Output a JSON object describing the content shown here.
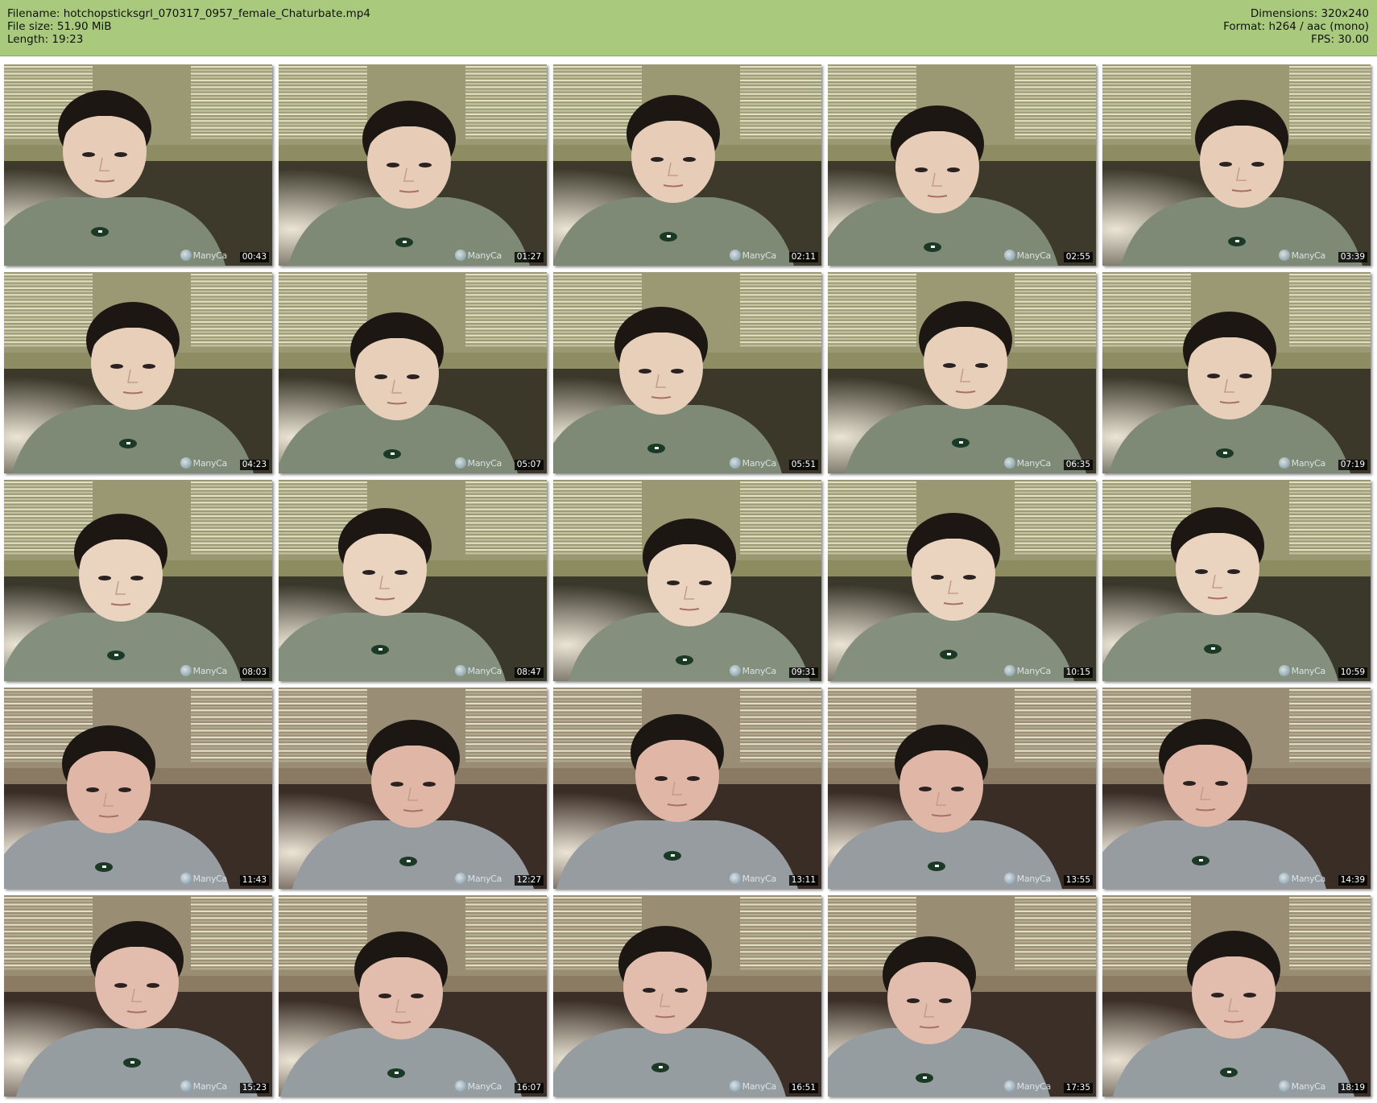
{
  "header": {
    "filename": "Filename: hotchopsticksgrl_070317_0957_female_Chaturbate.mp4",
    "filesize": "File size: 51.90 MiB",
    "length": "Length: 19:23",
    "dimensions": "Dimensions: 320x240",
    "format": "Format: h264 / aac (mono)",
    "fps": "FPS: 30.00"
  },
  "colors": {
    "header_bg": "#a9c97d",
    "page_bg": "#ffffff",
    "timestamp_bg": "#000000"
  },
  "thumbnails": [
    {
      "time": "00:43",
      "watermark": "ManyCa"
    },
    {
      "time": "01:27",
      "watermark": "ManyCa"
    },
    {
      "time": "02:11",
      "watermark": "ManyCa"
    },
    {
      "time": "02:55",
      "watermark": "ManyCa"
    },
    {
      "time": "03:39",
      "watermark": "ManyCa"
    },
    {
      "time": "04:23",
      "watermark": "ManyCa"
    },
    {
      "time": "05:07",
      "watermark": "ManyCa"
    },
    {
      "time": "05:51",
      "watermark": "ManyCa"
    },
    {
      "time": "06:35",
      "watermark": "ManyCa"
    },
    {
      "time": "07:19",
      "watermark": "ManyCa"
    },
    {
      "time": "08:03",
      "watermark": "ManyCa"
    },
    {
      "time": "08:47",
      "watermark": "ManyCa"
    },
    {
      "time": "09:31",
      "watermark": "ManyCa"
    },
    {
      "time": "10:15",
      "watermark": "ManyCa"
    },
    {
      "time": "10:59",
      "watermark": "ManyCa"
    },
    {
      "time": "11:43",
      "watermark": "ManyCa"
    },
    {
      "time": "12:27",
      "watermark": "ManyCa"
    },
    {
      "time": "13:11",
      "watermark": "ManyCa"
    },
    {
      "time": "13:55",
      "watermark": "ManyCa"
    },
    {
      "time": "14:39",
      "watermark": "ManyCa"
    },
    {
      "time": "15:23",
      "watermark": "ManyCa"
    },
    {
      "time": "16:07",
      "watermark": "ManyCa"
    },
    {
      "time": "16:51",
      "watermark": "ManyCa"
    },
    {
      "time": "17:35",
      "watermark": "ManyCa"
    },
    {
      "time": "18:19",
      "watermark": "ManyCa"
    }
  ]
}
